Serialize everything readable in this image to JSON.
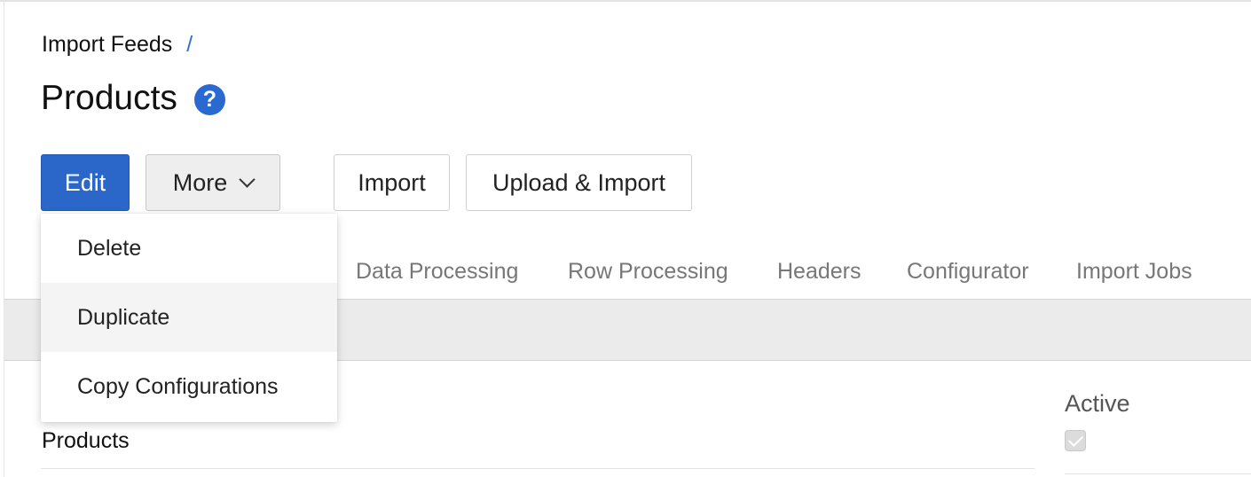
{
  "breadcrumb": {
    "items": [
      "Import Feeds"
    ],
    "separator": "/"
  },
  "header": {
    "title": "Products",
    "help_icon": "question-mark-icon"
  },
  "toolbar": {
    "edit_label": "Edit",
    "more_label": "More",
    "import_label": "Import",
    "upload_import_label": "Upload & Import"
  },
  "more_menu": {
    "items": [
      {
        "label": "Delete"
      },
      {
        "label": "Duplicate",
        "hovered": true
      },
      {
        "label": "Copy Configurations"
      }
    ]
  },
  "tabs": [
    {
      "label": "Data Processing"
    },
    {
      "label": "Row Processing"
    },
    {
      "label": "Headers"
    },
    {
      "label": "Configurator"
    },
    {
      "label": "Import Jobs"
    }
  ],
  "details": {
    "name_value": "Products",
    "active_label": "Active",
    "active_checked": true
  },
  "colors": {
    "primary": "#2b67c8",
    "help_icon_bg": "#2a6ad0",
    "breadcrumb_separator": "#2f6fd0"
  }
}
